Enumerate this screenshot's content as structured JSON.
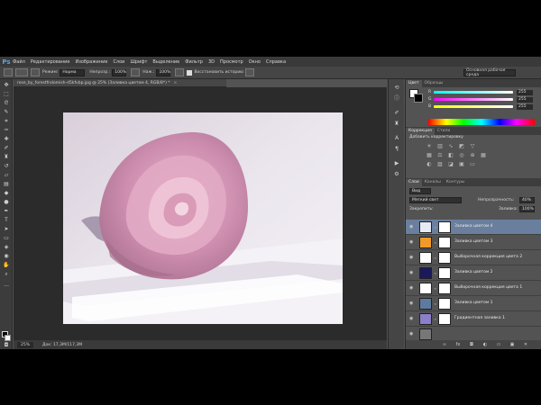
{
  "app": {
    "logo": "Ps",
    "menu": [
      "Файл",
      "Редактирование",
      "Изображение",
      "Слои",
      "Шрифт",
      "Выделение",
      "Фильтр",
      "3D",
      "Просмотр",
      "Окно",
      "Справка"
    ]
  },
  "options_bar": {
    "mode_label": "Режим:",
    "mode_value": "Норма",
    "opacity_label": "Непрозр.:",
    "opacity_value": "100%",
    "flow_label": "Наж.:",
    "flow_value": "100%",
    "history_label": "Восстановить историю",
    "workspace": "Основная рабочая среда"
  },
  "document": {
    "tab_title": "rose_by_forestfrolomish-d5kfvbp.jpg @ 25% (Заливка цветом 4, RGB/8*) *",
    "close_glyph": "×",
    "zoom": "25%",
    "doc_info": "Док: 17,3M/117,3M"
  },
  "panels": {
    "color_tabs": [
      "Цвет",
      "Образцы"
    ],
    "channels": [
      {
        "label": "R",
        "value": "255",
        "gradient": "linear-gradient(to right,#00ffff,#ffffff)"
      },
      {
        "label": "G",
        "value": "255",
        "gradient": "linear-gradient(to right,#ff00ff,#ffffff)"
      },
      {
        "label": "B",
        "value": "255",
        "gradient": "linear-gradient(to right,#ffff00,#ffffff)"
      }
    ],
    "adjustments_tabs": [
      "Коррекция",
      "Стили"
    ],
    "adjustments_title": "Добавить корректировку",
    "layers_tabs": [
      "Слои",
      "Каналы",
      "Контуры"
    ],
    "kind_label": "Вид",
    "blend_mode": "Мягкий свет",
    "opacity_label": "Непрозрачность:",
    "opacity_value": "40%",
    "lock_label": "Закрепить:",
    "fill_label": "Заливка:",
    "fill_value": "100%"
  },
  "layers": [
    {
      "name": "Заливка цветом 4",
      "thumb": "#e6eaf4",
      "selected": true
    },
    {
      "name": "Заливка цветом 3",
      "thumb": "#f09a2a",
      "selected": false
    },
    {
      "name": "Выборочная коррекция цвета 2",
      "thumb": "#ffffff",
      "selected": false
    },
    {
      "name": "Заливка цветом 2",
      "thumb": "#1a1a5a",
      "selected": false
    },
    {
      "name": "Выборочная коррекция цвета 1",
      "thumb": "#ffffff",
      "selected": false
    },
    {
      "name": "Заливка цветом 1",
      "thumb": "#5e7a9e",
      "selected": false
    },
    {
      "name": "Градиентная заливка 1",
      "thumb": "#8a7fc8",
      "selected": false
    }
  ],
  "icons": {
    "eye": "visibility-eye-icon",
    "link": "mask-link-icon"
  }
}
